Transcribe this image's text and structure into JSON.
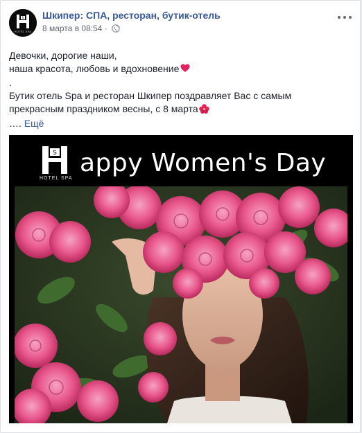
{
  "post": {
    "page_name": "Шкипер: СПА, ресторан, бутик-отель",
    "timestamp": "8 марта в 08:54",
    "privacy_icon": "globe-icon",
    "more_icon": "ellipsis-icon",
    "text": {
      "line1": "Девочки, дорогие наши,",
      "line2": "наша красота, любовь и вдохновение",
      "line3": ".",
      "line4": "Бутик отель Spa и ресторан Шкипер поздравляет Вас с самым",
      "line5": "прекрасным праздником весны, с 8 марта",
      "ellipsis": "….",
      "see_more": "Ещё"
    }
  },
  "image": {
    "banner_text": "appy Women's Day",
    "logo_letter": "H",
    "logo_sub": "HOTEL SPA",
    "avatar_sub": "HOTEL SPA"
  },
  "colors": {
    "link": "#365899",
    "meta": "#616770",
    "text": "#1d2129",
    "heart": "#e0245e",
    "rose": "#e8578a"
  }
}
